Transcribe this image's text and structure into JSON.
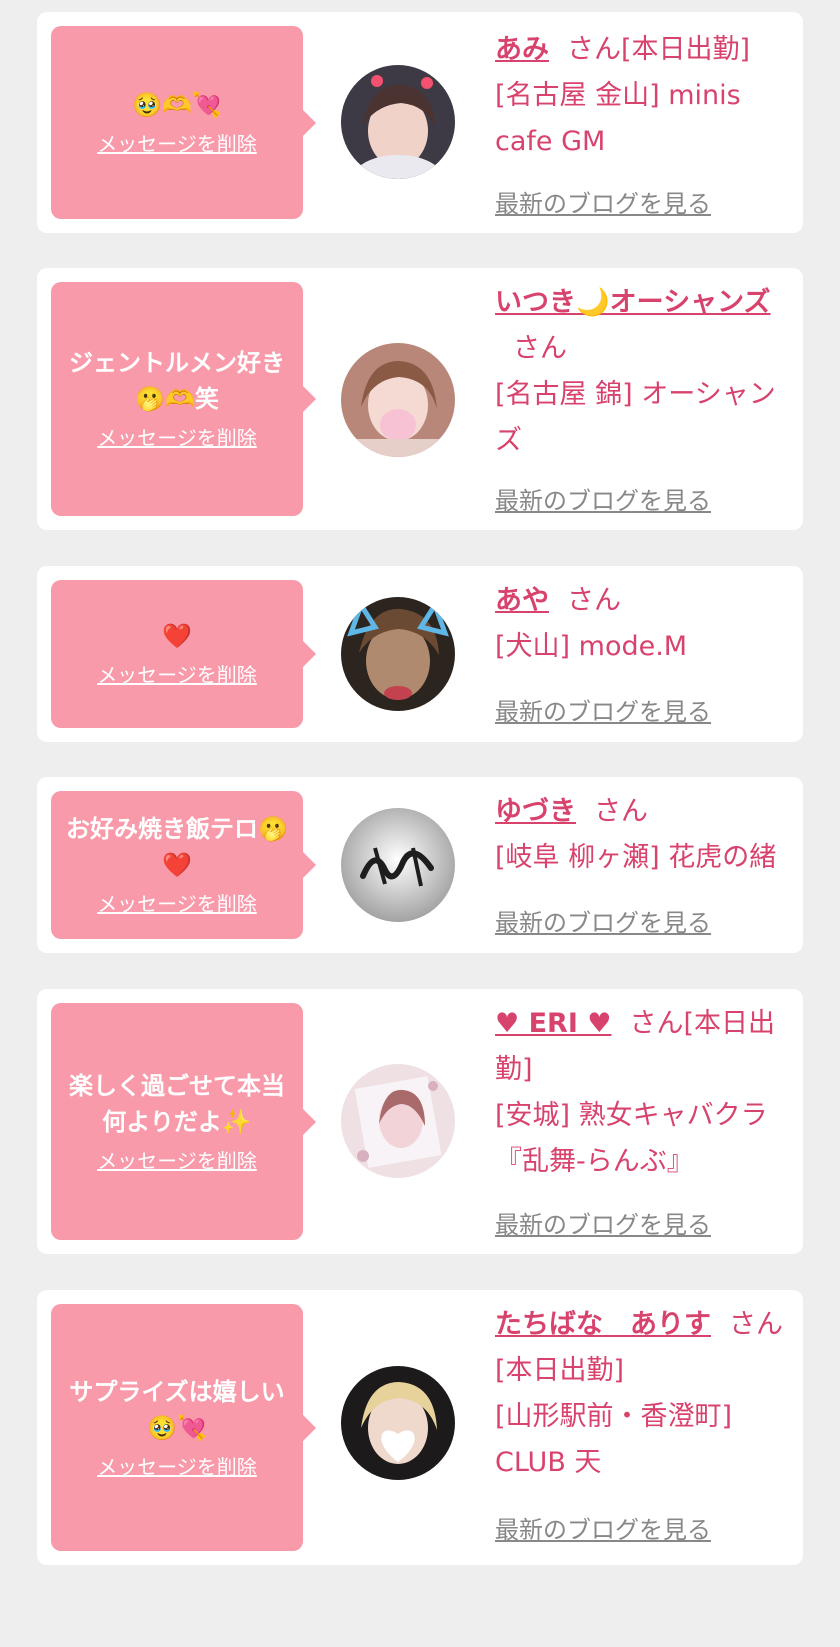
{
  "delete_label": "メッセージを削除",
  "blog_label": "最新のブログを見る",
  "san_label": "さん",
  "colors": {
    "accent": "#d8436d",
    "bubble": "#f99aaa",
    "card": "#ffffff",
    "background": "#eeeeee",
    "blog_link": "#888888"
  },
  "cards": [
    {
      "message": "🥹🫶💘",
      "name": "あみ",
      "status": "[本日出勤]",
      "shop": "[名古屋 金山] minis cafe GM"
    },
    {
      "message": "ジェントルメン好き🫢🫶笑",
      "name": "いつき🌙オーシャンズ",
      "status": "",
      "shop": "[名古屋 錦] オーシャンズ"
    },
    {
      "message": "❤️",
      "name": "あや",
      "status": "",
      "shop": "[犬山] mode.M"
    },
    {
      "message": "お好み焼き飯テロ🫢❤️",
      "name": "ゆづき",
      "status": "",
      "shop": "[岐阜 柳ヶ瀬] 花虎の緒"
    },
    {
      "message": "楽しく過ごせて本当何よりだよ✨",
      "name": "♥ ERI ♥",
      "status": "[本日出勤]",
      "shop": "[安城] 熟女キャバクラ『乱舞-らんぶ』"
    },
    {
      "message": "サプライズは嬉しい🥹💘",
      "name": "たちばな　ありす",
      "status": "[本日出勤]",
      "shop": "[山形駅前・香澄町] CLUB 天"
    }
  ]
}
